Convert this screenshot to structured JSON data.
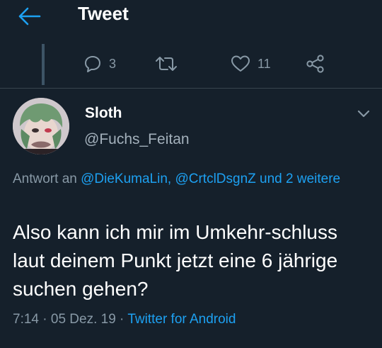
{
  "header": {
    "title": "Tweet",
    "back_icon": "arrow-left-icon",
    "accent_color": "#1da1f2"
  },
  "previous_tweet_actions": {
    "reply_count": "3",
    "retweet_count": "",
    "like_count": "11"
  },
  "tweet": {
    "author": {
      "display_name": "Sloth",
      "handle": "@Fuchs_Feitan"
    },
    "reply_context": {
      "prefix": "Antwort an ",
      "mention_1": "@DieKumaLin",
      "separator": ", ",
      "mention_2": "@CrtclDsgnZ",
      "suffix_linked": " und 2 weitere"
    },
    "text": "Also kann ich mir im Umkehr-schluss laut deinem Punkt jetzt eine 6 jährige suchen gehen?",
    "time": "7:14",
    "date": "05 Dez. 19",
    "dot": " · ",
    "source": "Twitter for Android"
  },
  "colors": {
    "background": "#15202b",
    "secondary_text": "#8899a6",
    "link": "#1da1f2",
    "divider": "#38444d"
  }
}
